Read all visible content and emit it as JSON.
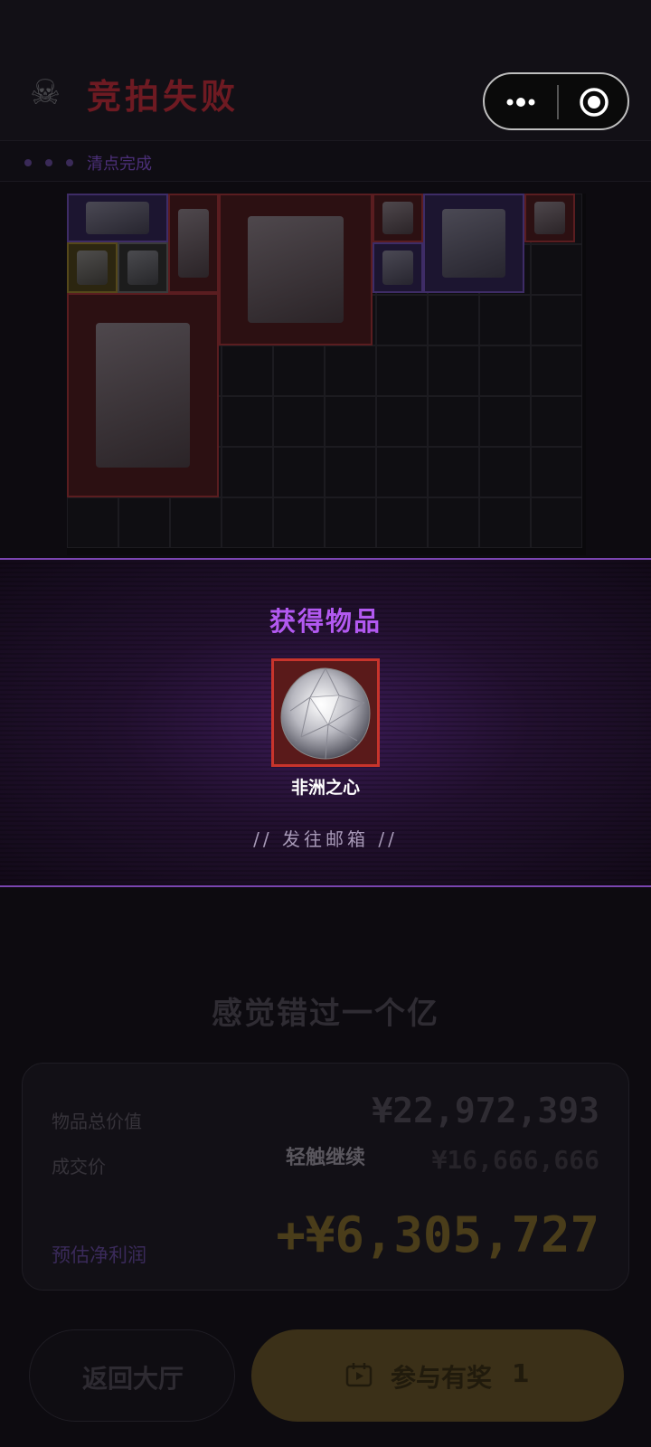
{
  "header": {
    "title": "竞拍失败",
    "skull_icon": "skull-icon",
    "menu_icons": [
      "more-dots-icon",
      "target-circle-icon"
    ]
  },
  "progress": {
    "status": "清点完成"
  },
  "inventory": {
    "items": [
      {
        "name": "boombox",
        "rarity": "purple"
      },
      {
        "name": "small-device",
        "rarity": "red"
      },
      {
        "name": "figurine",
        "rarity": "gold"
      },
      {
        "name": "tape-roll",
        "rarity": "gray"
      },
      {
        "name": "medical-monitor",
        "rarity": "red"
      },
      {
        "name": "gem-shard",
        "rarity": "red"
      },
      {
        "name": "molecule-model",
        "rarity": "purple"
      },
      {
        "name": "lab-instrument",
        "rarity": "purple"
      },
      {
        "name": "camera-part",
        "rarity": "red"
      },
      {
        "name": "server-tower",
        "rarity": "red"
      }
    ]
  },
  "modal": {
    "title": "获得物品",
    "prize_name": "非洲之心",
    "send_label": "// 发往邮箱 //"
  },
  "result": {
    "miss_text": "感觉错过一个亿",
    "total_value_label": "物品总价值",
    "total_value": "¥22,972,393",
    "deal_price_label": "成交价",
    "deal_price": "¥16,666,666",
    "profit_label": "预估净利润",
    "profit": "+¥6,305,727",
    "tap_continue": "轻触继续"
  },
  "buttons": {
    "back": "返回大厅",
    "reward": "参与有奖",
    "reward_count": "1"
  },
  "colors": {
    "accent_purple": "#b259f0",
    "title_red": "#6e1a22",
    "profit_gold": "#4a3d1a",
    "button_gold": "#3b3018"
  }
}
